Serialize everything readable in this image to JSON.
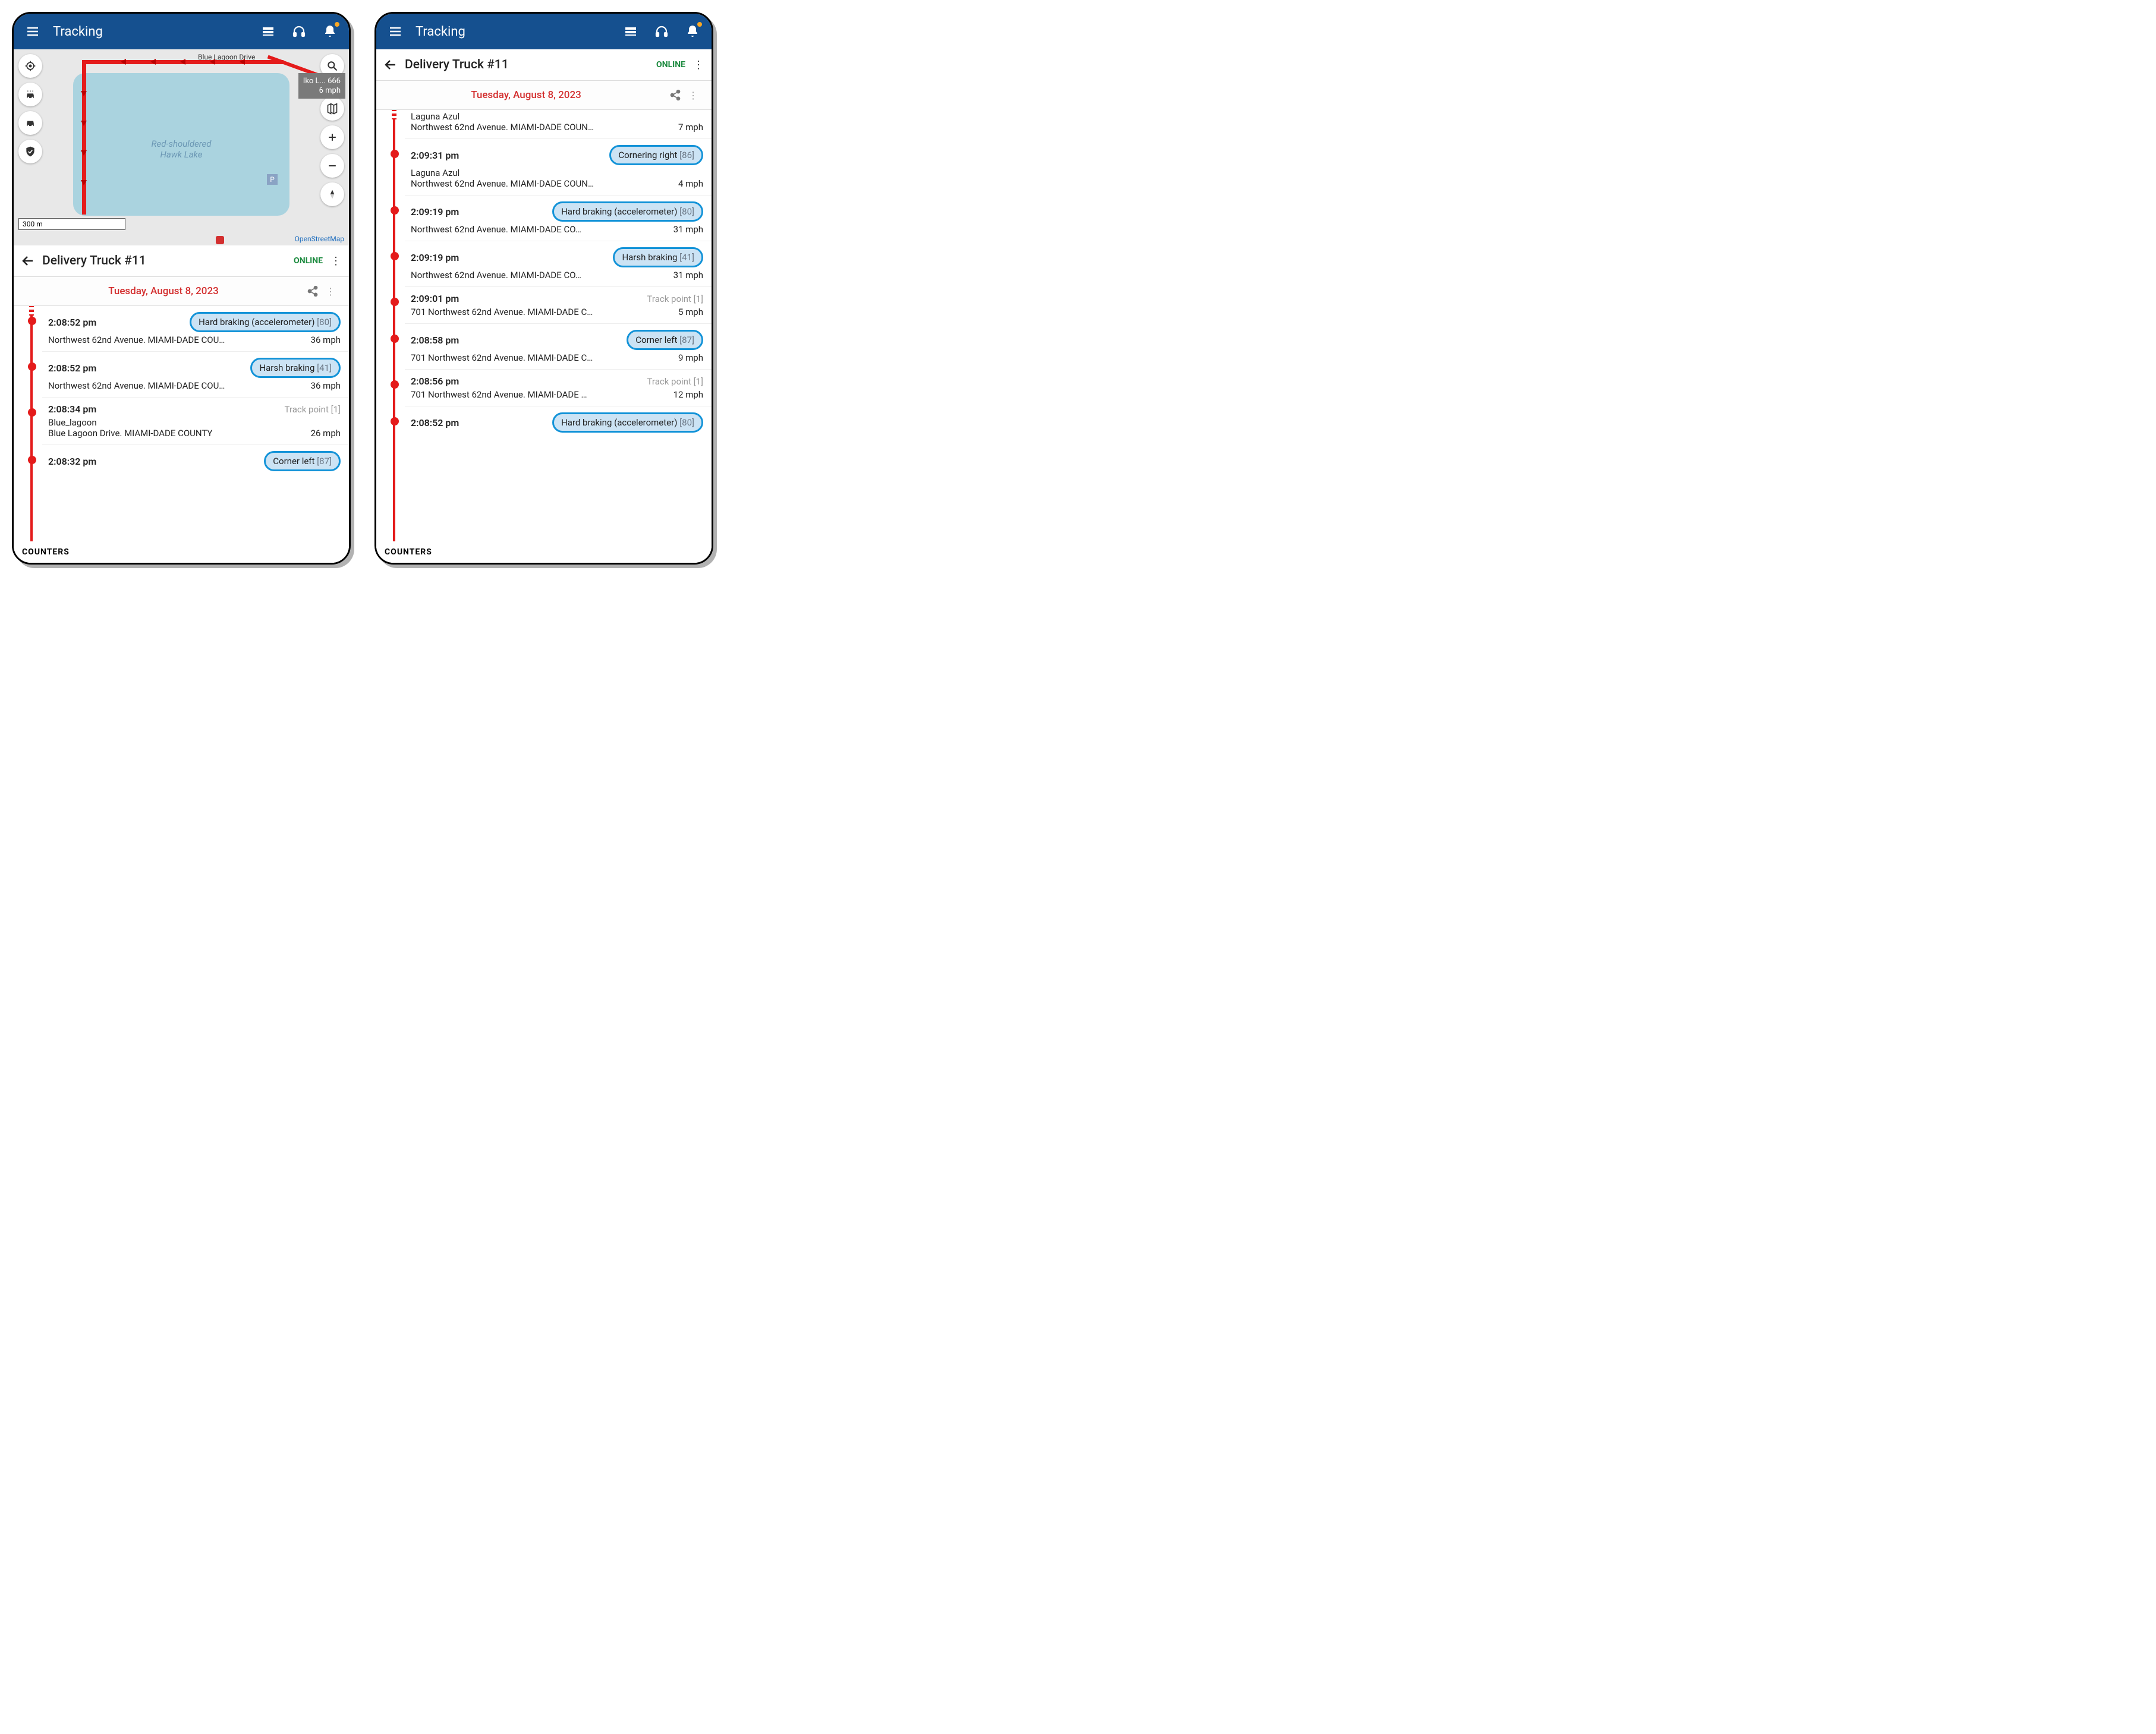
{
  "appbar": {
    "title": "Tracking"
  },
  "map": {
    "lake_label": "Red-shouldered\nHawk Lake",
    "street_label": "Blue Lagoon Drive",
    "scale": "300 m",
    "attribution": "OpenStreetMap",
    "tooltip_line1": "Iko L... 666",
    "tooltip_line2": "6 mph",
    "parking": "P"
  },
  "unit": {
    "name": "Delivery Truck #11",
    "status": "ONLINE",
    "date": "Tuesday, August 8, 2023"
  },
  "counters_label": "COUNTERS",
  "events_left": [
    {
      "time": "2:08:52 pm",
      "chip": "Hard braking (accelerometer)",
      "code": "[80]",
      "addr": "Northwest 62nd Avenue. MIAMI-DADE COU…",
      "speed": "36 mph"
    },
    {
      "time": "2:08:52 pm",
      "chip": "Harsh braking",
      "code": "[41]",
      "addr": "Northwest 62nd Avenue. MIAMI-DADE COU…",
      "speed": "36 mph"
    },
    {
      "time": "2:08:34 pm",
      "track": "Track point",
      "track_cnt": "[1]",
      "loc": "Blue_lagoon",
      "addr": "Blue Lagoon Drive. MIAMI-DADE COUNTY",
      "speed": "26 mph"
    },
    {
      "time": "2:08:32 pm",
      "chip": "Corner left",
      "code": "[87]"
    }
  ],
  "events_right": [
    {
      "loc": "Laguna Azul",
      "addr": "Northwest 62nd Avenue. MIAMI-DADE COUN…",
      "speed": "7 mph"
    },
    {
      "time": "2:09:31 pm",
      "chip": "Cornering right",
      "code": "[86]",
      "loc": "Laguna Azul",
      "addr": "Northwest 62nd Avenue. MIAMI-DADE COUN…",
      "speed": "4 mph"
    },
    {
      "time": "2:09:19 pm",
      "chip": "Hard braking (accelerometer)",
      "code": "[80]",
      "addr": "Northwest 62nd Avenue. MIAMI-DADE CO…",
      "speed": "31 mph"
    },
    {
      "time": "2:09:19 pm",
      "chip": "Harsh braking",
      "code": "[41]",
      "addr": "Northwest 62nd Avenue. MIAMI-DADE CO…",
      "speed": "31 mph"
    },
    {
      "time": "2:09:01 pm",
      "track": "Track point",
      "track_cnt": "[1]",
      "addr": "701 Northwest 62nd Avenue. MIAMI-DADE C…",
      "speed": "5 mph"
    },
    {
      "time": "2:08:58 pm",
      "chip": "Corner left",
      "code": "[87]",
      "addr": "701 Northwest 62nd Avenue. MIAMI-DADE C…",
      "speed": "9 mph"
    },
    {
      "time": "2:08:56 pm",
      "track": "Track point",
      "track_cnt": "[1]",
      "addr": "701 Northwest 62nd Avenue. MIAMI-DADE …",
      "speed": "12 mph"
    },
    {
      "time": "2:08:52 pm",
      "chip": "Hard braking (accelerometer)",
      "code": "[80]"
    }
  ]
}
